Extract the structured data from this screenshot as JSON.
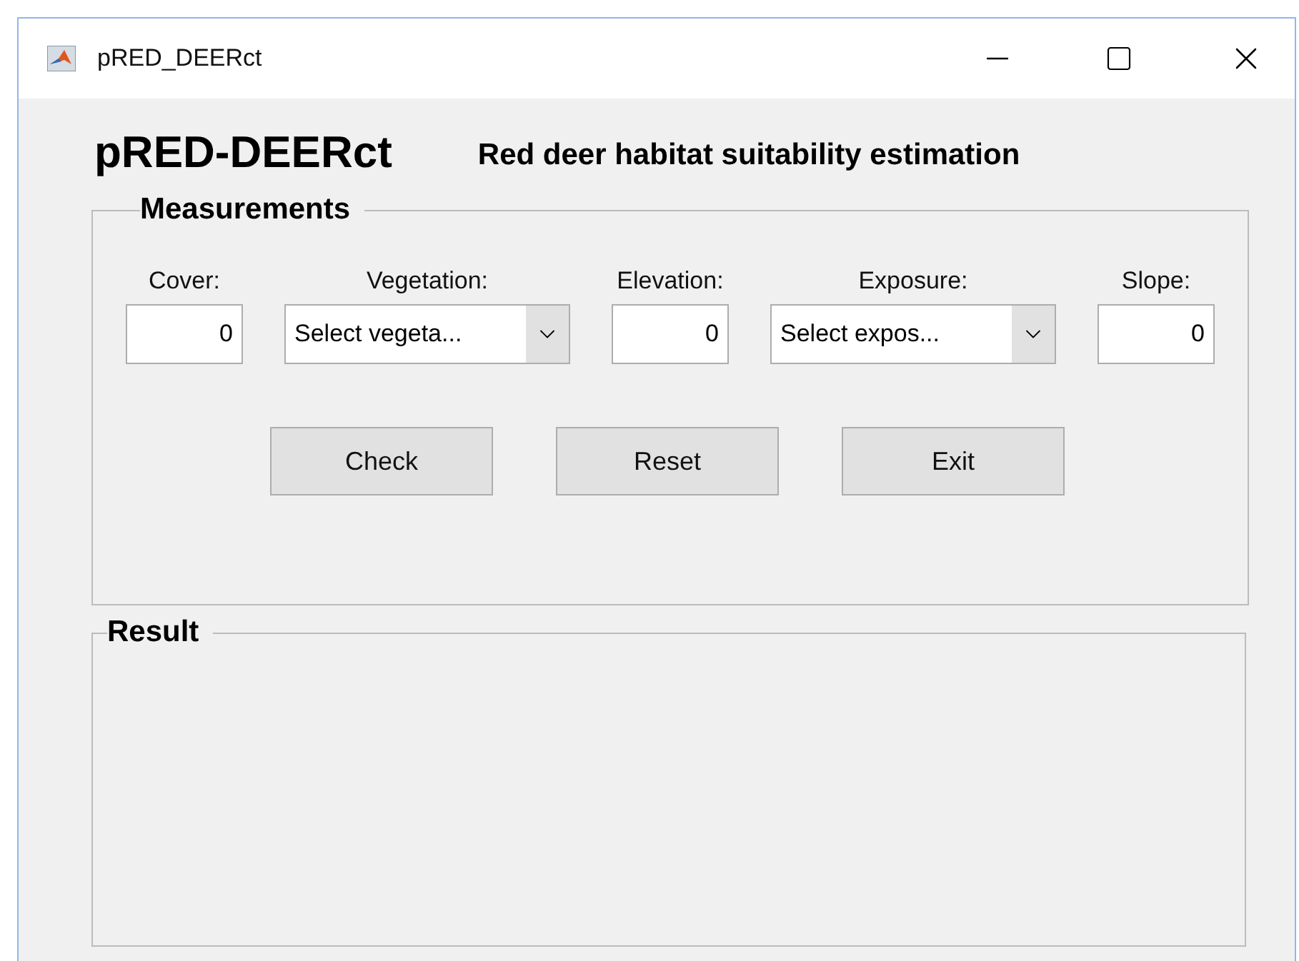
{
  "window": {
    "title": "pRED_DEERct"
  },
  "header": {
    "title": "pRED-DEERct",
    "subtitle": "Red deer habitat suitability estimation"
  },
  "measurements": {
    "title": "Measurements",
    "fields": [
      {
        "label": "Cover:",
        "kind": "text",
        "value": "0"
      },
      {
        "label": "Vegetation:",
        "kind": "dropdown",
        "value": "Select vegeta..."
      },
      {
        "label": "Elevation:",
        "kind": "text",
        "value": "0"
      },
      {
        "label": "Exposure:",
        "kind": "dropdown",
        "value": "Select expos..."
      },
      {
        "label": "Slope:",
        "kind": "text",
        "value": "0"
      }
    ],
    "buttons": [
      "Check",
      "Reset",
      "Exit"
    ]
  },
  "result": {
    "title": "Result"
  }
}
